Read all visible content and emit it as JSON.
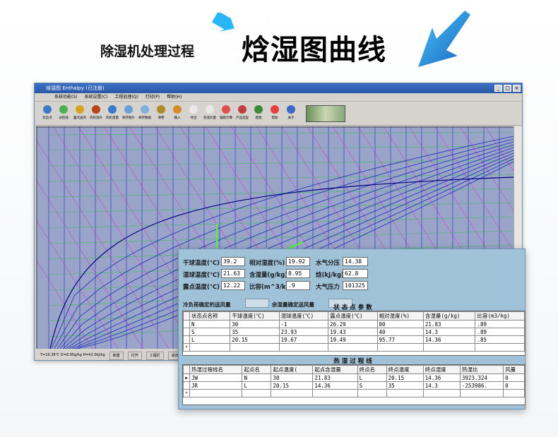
{
  "banner": {
    "title_small": "除湿机处理过程",
    "title_big": "焓湿图曲线"
  },
  "window": {
    "title": "焓湿图 Enthalpy (已注册)",
    "menus": [
      "系统功能(S)",
      "系统设置(C)",
      "工程处理(Q)",
      "打印(P)",
      "帮助(H)"
    ],
    "tools": [
      {
        "label": "状态点",
        "color": "#3a7ac8"
      },
      {
        "label": "过程线",
        "color": "#4caf50"
      },
      {
        "label": "露点送风",
        "color": "#d6a21e"
      },
      {
        "label": "风机温升",
        "color": "#b8441e"
      },
      {
        "label": "风机温量",
        "color": "#3a7ac8"
      },
      {
        "label": "保存图片",
        "color": "#6aa0d8"
      },
      {
        "label": "保存数据",
        "color": "#7fb0e0"
      },
      {
        "label": "清零",
        "color": "#b08a2a"
      },
      {
        "label": "输入",
        "color": "#d88a2a"
      },
      {
        "label": "导出",
        "color": "#e8e8e8"
      },
      {
        "label": "热湿比量",
        "color": "#e8e8e8"
      },
      {
        "label": "辅助计算",
        "color": "#e05050"
      },
      {
        "label": "产品选型",
        "color": "#c04040"
      },
      {
        "label": "底图",
        "color": "#3a8a3a"
      },
      {
        "label": "帮助",
        "color": "#e84040"
      },
      {
        "label": "关于",
        "color": "#3a6ac8"
      }
    ],
    "status": {
      "readout": "T=19.38℃ D=8.95g/kg H=42.0kJ/kg",
      "buttons": [
        "新建",
        "打开",
        "工程栏",
        "退出"
      ]
    }
  },
  "panel": {
    "fields": [
      {
        "label": "干球温度(℃)",
        "value": "39.2"
      },
      {
        "label": "相对湿度(%)",
        "value": "19.92"
      },
      {
        "label": "水气分压",
        "value": "14.38"
      },
      {
        "label": "湿球温度(℃)",
        "value": "21.63"
      },
      {
        "label": "含湿量(g/kg)",
        "value": "8.95"
      },
      {
        "label": "焓(kJ/kg)",
        "value": "62.8"
      },
      {
        "label": "露点温度(℃)",
        "value": "12.22"
      },
      {
        "label": "比容(m^3/kg)",
        "value": ".9"
      },
      {
        "label": "大气压力",
        "value": "101325"
      }
    ],
    "cold_load_label": "冷负荷确定的送风量",
    "wet_load_label": "余湿量确定送风量",
    "state_table": {
      "title": "状态点参数",
      "headers": [
        "状态点名称",
        "干球温度(℃)",
        "湿球温度(℃)",
        "露点温度(℃)",
        "相对湿度(%)",
        "含湿量(g/kg)",
        "比容(m3/kg)"
      ],
      "rows": [
        {
          "marker": "",
          "cells": [
            "N",
            "30",
            "-1",
            "26.29",
            "80",
            "21.83",
            ".89"
          ]
        },
        {
          "marker": "",
          "cells": [
            "S",
            "35",
            "23.93",
            "19.43",
            "40",
            "14.3",
            ".89"
          ]
        },
        {
          "marker": "",
          "cells": [
            "L",
            "20.15",
            "19.67",
            "19.49",
            "95.77",
            "14.36",
            ".85"
          ]
        },
        {
          "marker": "*",
          "cells": [
            "",
            "",
            "",
            "",
            "",
            "",
            ""
          ]
        }
      ]
    },
    "process_table": {
      "title": "热湿过程线",
      "headers": [
        "热湿过程线名",
        "起点名",
        "起点温度(",
        "起点含湿量",
        "终点名",
        "终点温度",
        "终点湿度",
        "热湿比",
        "风量"
      ],
      "rows": [
        {
          "marker": "▶",
          "cells": [
            "JW",
            "N",
            "30",
            "21.83",
            "L",
            "20.15",
            "14.36",
            "3923.324",
            "0"
          ]
        },
        {
          "marker": "",
          "cells": [
            "JR",
            "L",
            "20.15",
            "14.36",
            "S",
            "35",
            "14.3",
            "-253986.",
            "0"
          ]
        },
        {
          "marker": "*",
          "cells": [
            "",
            "",
            "",
            "",
            "",
            "",
            "",
            "",
            ""
          ]
        }
      ]
    }
  },
  "colors": {
    "chart_bg": "#9aa4c8",
    "grid_blue": "#1a2db8",
    "grid_magenta": "#d81ad8",
    "grid_green": "#3ac060",
    "process_line": "#4cff2a"
  }
}
